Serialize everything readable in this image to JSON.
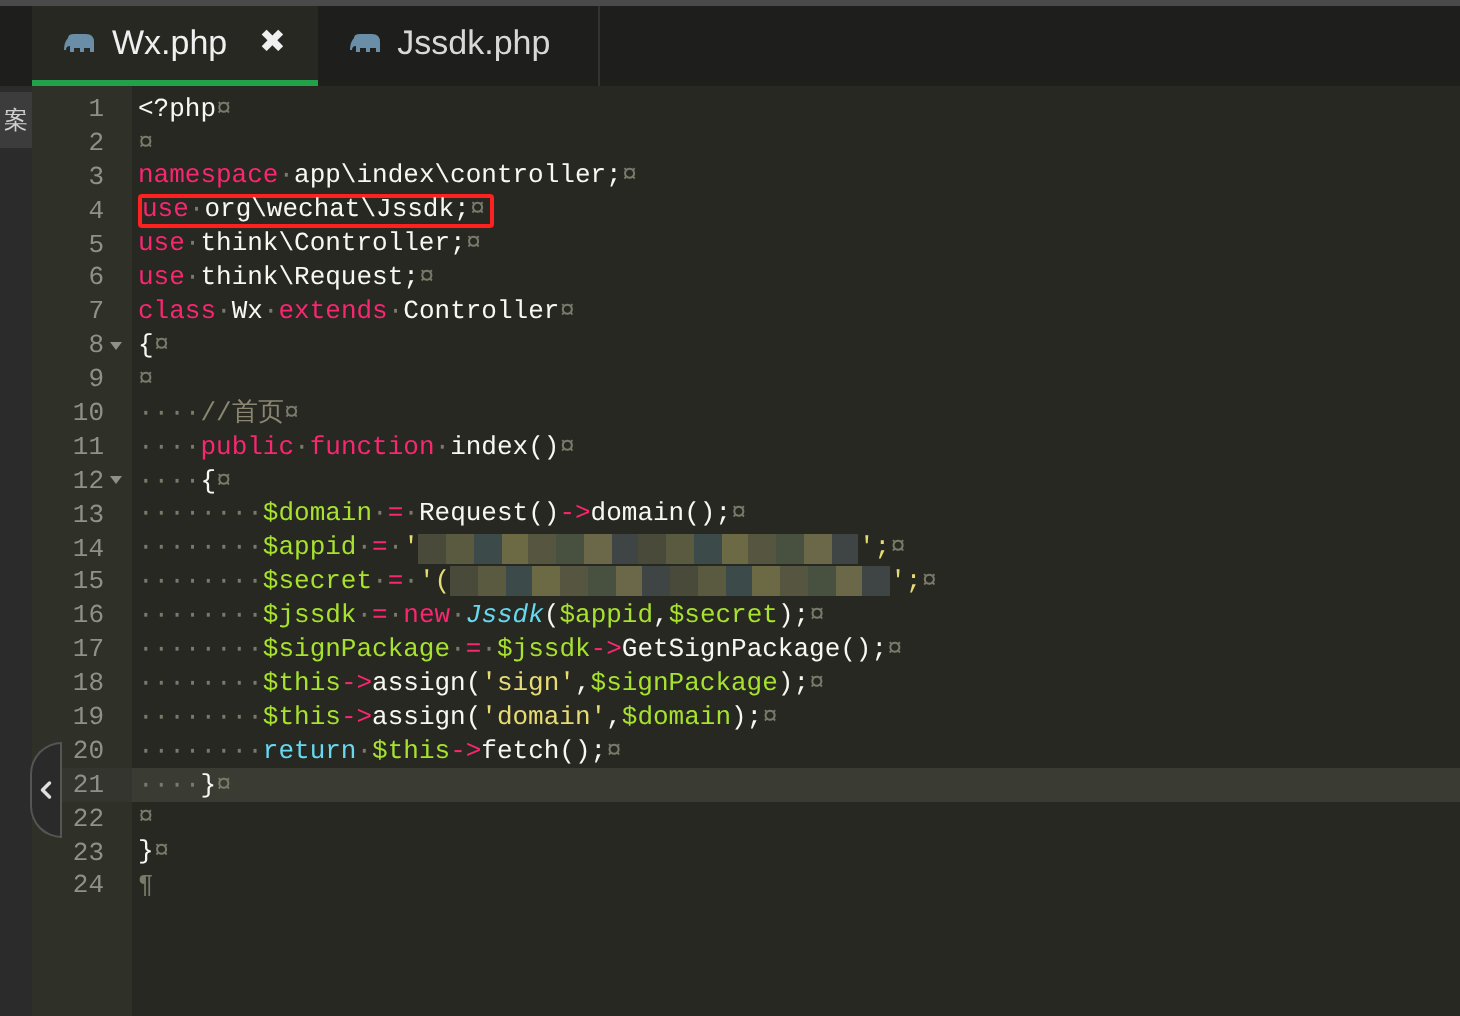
{
  "side_panel": {
    "label": "案"
  },
  "tabs": [
    {
      "label": "Wx.php",
      "selected": true,
      "close": "✖"
    },
    {
      "label": "Jssdk.php",
      "selected": false
    }
  ],
  "editor": {
    "lines": [
      {
        "n": "1",
        "tokens": [
          {
            "text": "<?php",
            "kind": "plain"
          },
          {
            "text": "¤",
            "kind": "whitespace"
          }
        ]
      },
      {
        "n": "2",
        "tokens": [
          {
            "text": "¤",
            "kind": "whitespace"
          }
        ]
      },
      {
        "n": "3",
        "tokens": [
          {
            "text": "namespace",
            "kind": "keyword"
          },
          {
            "text": "·",
            "kind": "whitespace"
          },
          {
            "text": "app\\index\\controller;",
            "kind": "plain"
          },
          {
            "text": "¤",
            "kind": "whitespace"
          }
        ]
      },
      {
        "n": "4",
        "highlighted": true,
        "tokens": [
          {
            "text": "use",
            "kind": "keyword"
          },
          {
            "text": "·",
            "kind": "whitespace"
          },
          {
            "text": "org\\wechat\\Jssdk;",
            "kind": "plain"
          },
          {
            "text": "¤",
            "kind": "whitespace"
          }
        ]
      },
      {
        "n": "5",
        "tokens": [
          {
            "text": "use",
            "kind": "keyword"
          },
          {
            "text": "·",
            "kind": "whitespace"
          },
          {
            "text": "think\\Controller;",
            "kind": "plain"
          },
          {
            "text": "¤",
            "kind": "whitespace"
          }
        ]
      },
      {
        "n": "6",
        "tokens": [
          {
            "text": "use",
            "kind": "keyword"
          },
          {
            "text": "·",
            "kind": "whitespace"
          },
          {
            "text": "think\\Request;",
            "kind": "plain"
          },
          {
            "text": "¤",
            "kind": "whitespace"
          }
        ]
      },
      {
        "n": "7",
        "tokens": [
          {
            "text": "class",
            "kind": "keyword"
          },
          {
            "text": "·",
            "kind": "whitespace"
          },
          {
            "text": "Wx",
            "kind": "plain"
          },
          {
            "text": "·",
            "kind": "whitespace"
          },
          {
            "text": "extends",
            "kind": "keyword"
          },
          {
            "text": "·",
            "kind": "whitespace"
          },
          {
            "text": "Controller",
            "kind": "plain"
          },
          {
            "text": "¤",
            "kind": "whitespace"
          }
        ]
      },
      {
        "n": "8",
        "foldable": true,
        "tokens": [
          {
            "text": "{",
            "kind": "plain"
          },
          {
            "text": "¤",
            "kind": "whitespace"
          }
        ]
      },
      {
        "n": "9",
        "tokens": [
          {
            "text": "¤",
            "kind": "whitespace"
          }
        ]
      },
      {
        "n": "10",
        "tokens": [
          {
            "text": "····",
            "kind": "whitespace"
          },
          {
            "text": "//首页",
            "kind": "comment"
          },
          {
            "text": "¤",
            "kind": "whitespace"
          }
        ]
      },
      {
        "n": "11",
        "tokens": [
          {
            "text": "····",
            "kind": "whitespace"
          },
          {
            "text": "public",
            "kind": "keyword"
          },
          {
            "text": "·",
            "kind": "whitespace"
          },
          {
            "text": "function",
            "kind": "keyword"
          },
          {
            "text": "·",
            "kind": "whitespace"
          },
          {
            "text": "index()",
            "kind": "plain"
          },
          {
            "text": "¤",
            "kind": "whitespace"
          }
        ]
      },
      {
        "n": "12",
        "foldable": true,
        "tokens": [
          {
            "text": "····",
            "kind": "whitespace"
          },
          {
            "text": "{",
            "kind": "plain"
          },
          {
            "text": "¤",
            "kind": "whitespace"
          }
        ]
      },
      {
        "n": "13",
        "tokens": [
          {
            "text": "········",
            "kind": "whitespace"
          },
          {
            "text": "$domain",
            "kind": "variable"
          },
          {
            "text": "·",
            "kind": "whitespace"
          },
          {
            "text": "=",
            "kind": "keyword"
          },
          {
            "text": "·",
            "kind": "whitespace"
          },
          {
            "text": "Request()",
            "kind": "plain"
          },
          {
            "text": "->",
            "kind": "keyword"
          },
          {
            "text": "domain();",
            "kind": "plain"
          },
          {
            "text": "¤",
            "kind": "whitespace"
          }
        ]
      },
      {
        "n": "14",
        "tokens": [
          {
            "text": "········",
            "kind": "whitespace"
          },
          {
            "text": "$appid",
            "kind": "variable"
          },
          {
            "text": "·",
            "kind": "whitespace"
          },
          {
            "text": "=",
            "kind": "keyword"
          },
          {
            "text": "·",
            "kind": "whitespace"
          },
          {
            "text": "'",
            "kind": "string"
          },
          {
            "kind": "blur"
          },
          {
            "text": "';",
            "kind": "string"
          },
          {
            "text": "¤",
            "kind": "whitespace"
          }
        ]
      },
      {
        "n": "15",
        "tokens": [
          {
            "text": "········",
            "kind": "whitespace"
          },
          {
            "text": "$secret",
            "kind": "variable"
          },
          {
            "text": "·",
            "kind": "whitespace"
          },
          {
            "text": "=",
            "kind": "keyword"
          },
          {
            "text": "·",
            "kind": "whitespace"
          },
          {
            "text": "'(",
            "kind": "string"
          },
          {
            "kind": "blur"
          },
          {
            "text": "';",
            "kind": "string"
          },
          {
            "text": "¤",
            "kind": "whitespace"
          }
        ]
      },
      {
        "n": "16",
        "tokens": [
          {
            "text": "········",
            "kind": "whitespace"
          },
          {
            "text": "$jssdk",
            "kind": "variable"
          },
          {
            "text": "·",
            "kind": "whitespace"
          },
          {
            "text": "=",
            "kind": "keyword"
          },
          {
            "text": "·",
            "kind": "whitespace"
          },
          {
            "text": "new",
            "kind": "keyword"
          },
          {
            "text": "·",
            "kind": "whitespace"
          },
          {
            "text": "Jssdk",
            "kind": "class"
          },
          {
            "text": "(",
            "kind": "plain"
          },
          {
            "text": "$appid",
            "kind": "variable"
          },
          {
            "text": ",",
            "kind": "plain"
          },
          {
            "text": "$secret",
            "kind": "variable"
          },
          {
            "text": ");",
            "kind": "plain"
          },
          {
            "text": "¤",
            "kind": "whitespace"
          }
        ]
      },
      {
        "n": "17",
        "tokens": [
          {
            "text": "········",
            "kind": "whitespace"
          },
          {
            "text": "$signPackage",
            "kind": "variable"
          },
          {
            "text": "·",
            "kind": "whitespace"
          },
          {
            "text": "=",
            "kind": "keyword"
          },
          {
            "text": "·",
            "kind": "whitespace"
          },
          {
            "text": "$jssdk",
            "kind": "variable"
          },
          {
            "text": "->",
            "kind": "keyword"
          },
          {
            "text": "GetSignPackage();",
            "kind": "plain"
          },
          {
            "text": "¤",
            "kind": "whitespace"
          }
        ]
      },
      {
        "n": "18",
        "tokens": [
          {
            "text": "········",
            "kind": "whitespace"
          },
          {
            "text": "$this",
            "kind": "variable"
          },
          {
            "text": "->",
            "kind": "keyword"
          },
          {
            "text": "assign(",
            "kind": "plain"
          },
          {
            "text": "'sign'",
            "kind": "string"
          },
          {
            "text": ",",
            "kind": "plain"
          },
          {
            "text": "$signPackage",
            "kind": "variable"
          },
          {
            "text": ");",
            "kind": "plain"
          },
          {
            "text": "¤",
            "kind": "whitespace"
          }
        ]
      },
      {
        "n": "19",
        "tokens": [
          {
            "text": "········",
            "kind": "whitespace"
          },
          {
            "text": "$this",
            "kind": "variable"
          },
          {
            "text": "->",
            "kind": "keyword"
          },
          {
            "text": "assign(",
            "kind": "plain"
          },
          {
            "text": "'domain'",
            "kind": "string"
          },
          {
            "text": ",",
            "kind": "plain"
          },
          {
            "text": "$domain",
            "kind": "variable"
          },
          {
            "text": ");",
            "kind": "plain"
          },
          {
            "text": "¤",
            "kind": "whitespace"
          }
        ]
      },
      {
        "n": "20",
        "tokens": [
          {
            "text": "········",
            "kind": "whitespace"
          },
          {
            "text": "return",
            "kind": "return"
          },
          {
            "text": "·",
            "kind": "whitespace"
          },
          {
            "text": "$this",
            "kind": "variable"
          },
          {
            "text": "->",
            "kind": "keyword"
          },
          {
            "text": "fetch();",
            "kind": "plain"
          },
          {
            "text": "¤",
            "kind": "whitespace"
          }
        ]
      },
      {
        "n": "21",
        "current": true,
        "tokens": [
          {
            "text": "····",
            "kind": "whitespace"
          },
          {
            "text": "}",
            "kind": "plain"
          },
          {
            "text": "¤",
            "kind": "whitespace"
          }
        ]
      },
      {
        "n": "22",
        "tokens": [
          {
            "text": "¤",
            "kind": "whitespace"
          }
        ]
      },
      {
        "n": "23",
        "tokens": [
          {
            "text": "}",
            "kind": "plain"
          },
          {
            "text": "¤",
            "kind": "whitespace"
          }
        ]
      },
      {
        "n": "24",
        "tokens": [
          {
            "text": "¶",
            "kind": "whitespace"
          }
        ]
      }
    ]
  }
}
